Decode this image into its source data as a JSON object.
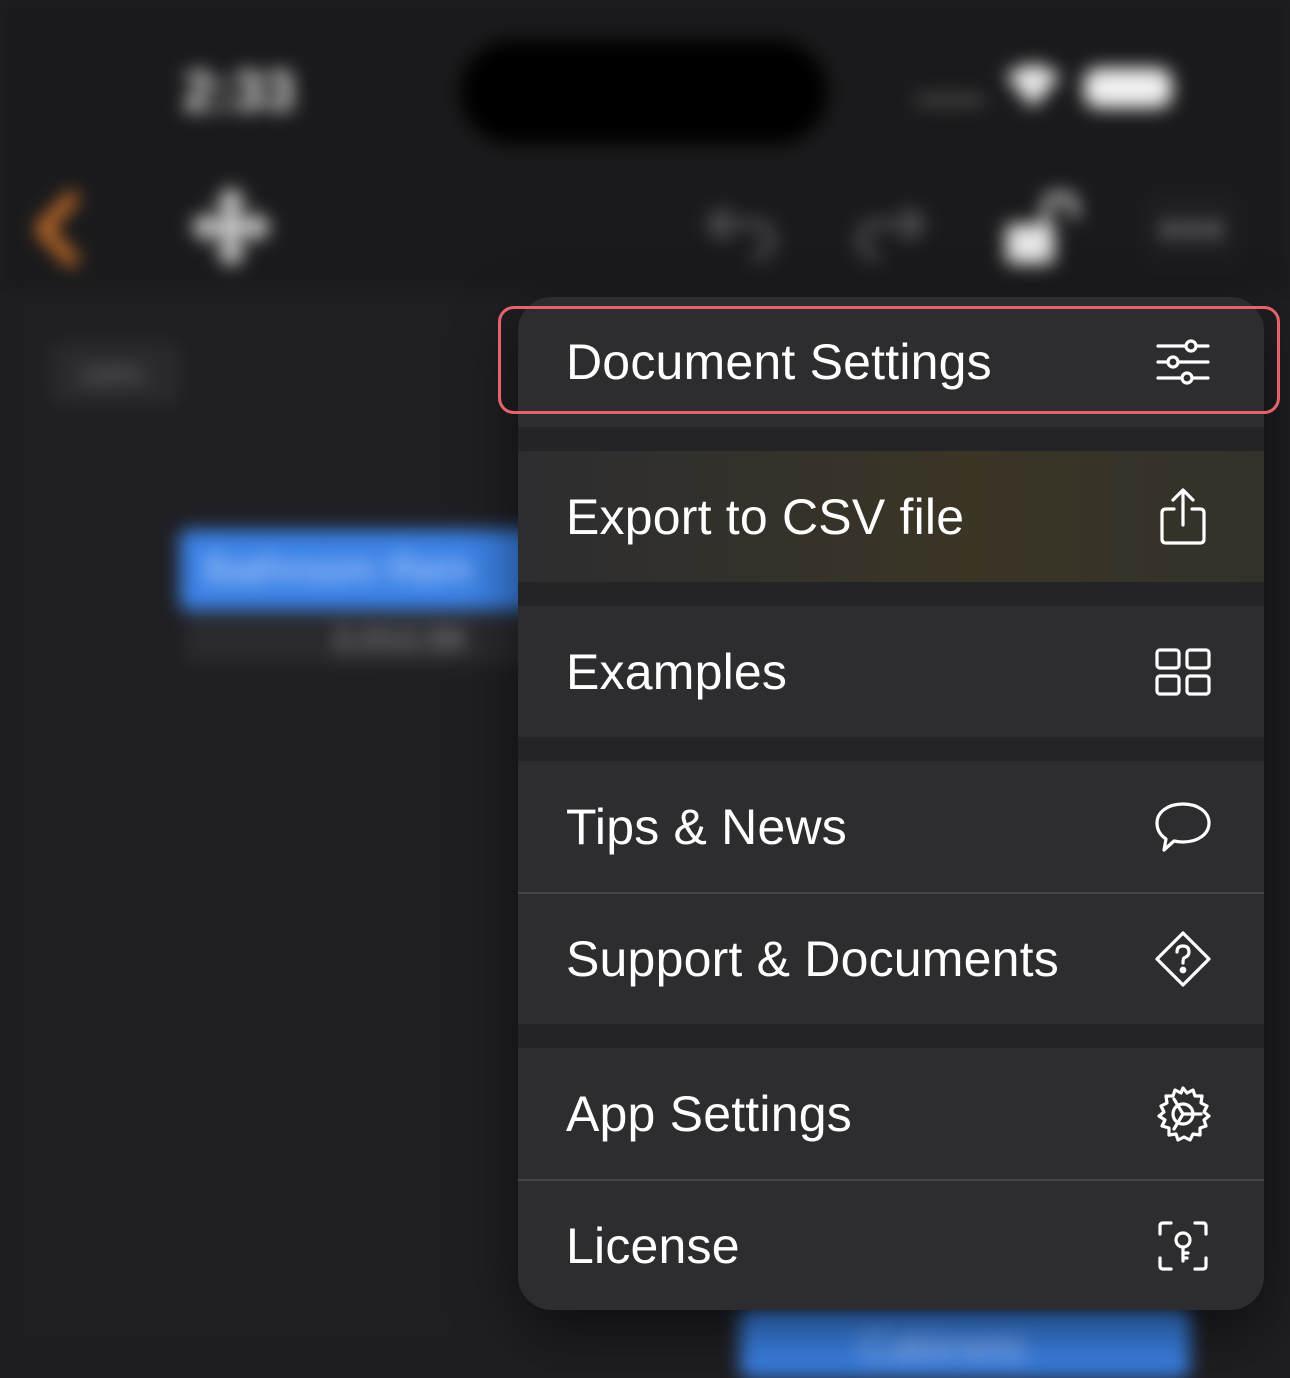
{
  "status_bar": {
    "time": "2:33"
  },
  "toolbar": {
    "back_icon": "chevron-left-icon",
    "move_icon": "move-arrows-icon",
    "undo_icon": "undo-icon",
    "redo_icon": "redo-icon",
    "lock_icon": "unlock-icon",
    "more_icon": "ellipsis-icon",
    "accent_color": "#e07a2a"
  },
  "canvas": {
    "zoom_label": "100%",
    "node_a_label": "Bathroom Rem",
    "node_a_value": "2,012.56",
    "node_b_label": "Cabinets",
    "node_color": "#3b82e6"
  },
  "menu": {
    "items": [
      {
        "label": "Document Settings",
        "icon": "sliders-icon",
        "highlighted": true
      },
      {
        "label": "Export to CSV file",
        "icon": "share-icon"
      },
      {
        "label": "Examples",
        "icon": "grid-icon"
      },
      {
        "label": "Tips & News",
        "icon": "speech-bubble-icon"
      },
      {
        "label": "Support & Documents",
        "icon": "help-diamond-icon"
      },
      {
        "label": "App Settings",
        "icon": "gear-icon"
      },
      {
        "label": "License",
        "icon": "key-icon"
      }
    ],
    "highlight_color": "#e8626b"
  }
}
